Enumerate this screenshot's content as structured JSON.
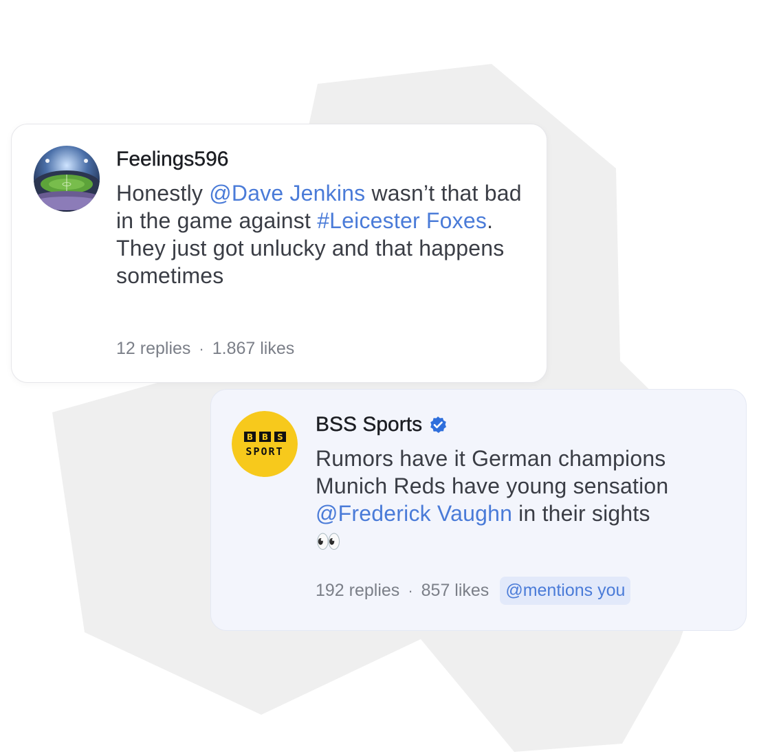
{
  "colors": {
    "link": "#4a7bd8",
    "text": "#3a3d45",
    "muted": "#7b7f88",
    "backdrop": "#efefef",
    "bss_yellow": "#f7c91c",
    "verified_blue": "#2f6fdc"
  },
  "posts": [
    {
      "avatar_icon": "stadium-avatar",
      "username": "Feelings596",
      "verified": false,
      "text_parts": [
        {
          "text": "Honestly ",
          "type": "plain"
        },
        {
          "text": "@Dave Jenkins",
          "type": "mention"
        },
        {
          "text": " wasn’t that bad in the game against ",
          "type": "plain"
        },
        {
          "text": "#Leicester Foxes",
          "type": "hashtag"
        },
        {
          "text": ". They just got unlucky and that happens sometimes",
          "type": "plain"
        }
      ],
      "replies": "12 replies",
      "separator": "·",
      "likes": "1.867 likes"
    },
    {
      "avatar_icon": "bbs-sport-logo-avatar",
      "avatar_logo_top": [
        "B",
        "B",
        "S"
      ],
      "avatar_logo_bottom": "SPORT",
      "username": "BSS Sports",
      "verified": true,
      "text_parts": [
        {
          "text": "Rumors have it German champions Munich Reds have young sensation ",
          "type": "plain"
        },
        {
          "text": "@Frederick Vaughn",
          "type": "mention"
        },
        {
          "text": " in their sights",
          "type": "plain"
        }
      ],
      "emoji": "👀",
      "replies": "192 replies",
      "separator": "·",
      "likes": "857 likes",
      "badge": "@mentions you"
    }
  ]
}
